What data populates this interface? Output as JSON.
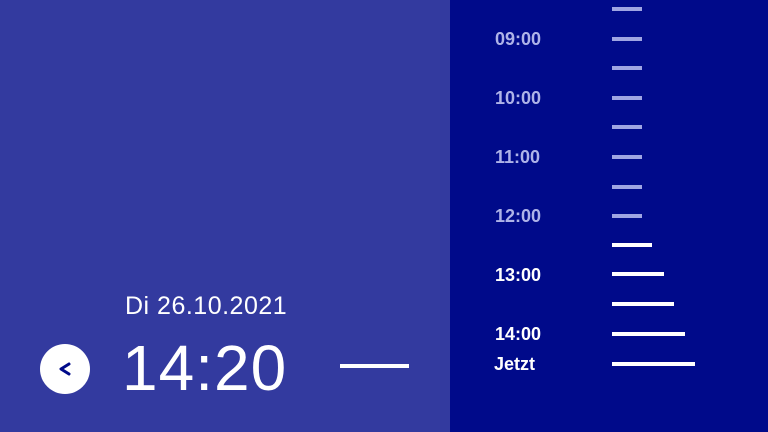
{
  "colors": {
    "left_background": "#333a9f",
    "right_background": "#000a8a",
    "foreground": "#ffffff",
    "past_label": "#aeb3e8",
    "past_tick": "#9fa5e3"
  },
  "date": "Di 26.10.2021",
  "time": "14:20",
  "back_button": {
    "icon": "chevron-left-icon",
    "glyph": "<"
  },
  "timeline": {
    "hour_labels": [
      "09:00",
      "10:00",
      "11:00",
      "12:00",
      "13:00",
      "14:00"
    ],
    "now_label": "Jetzt"
  }
}
